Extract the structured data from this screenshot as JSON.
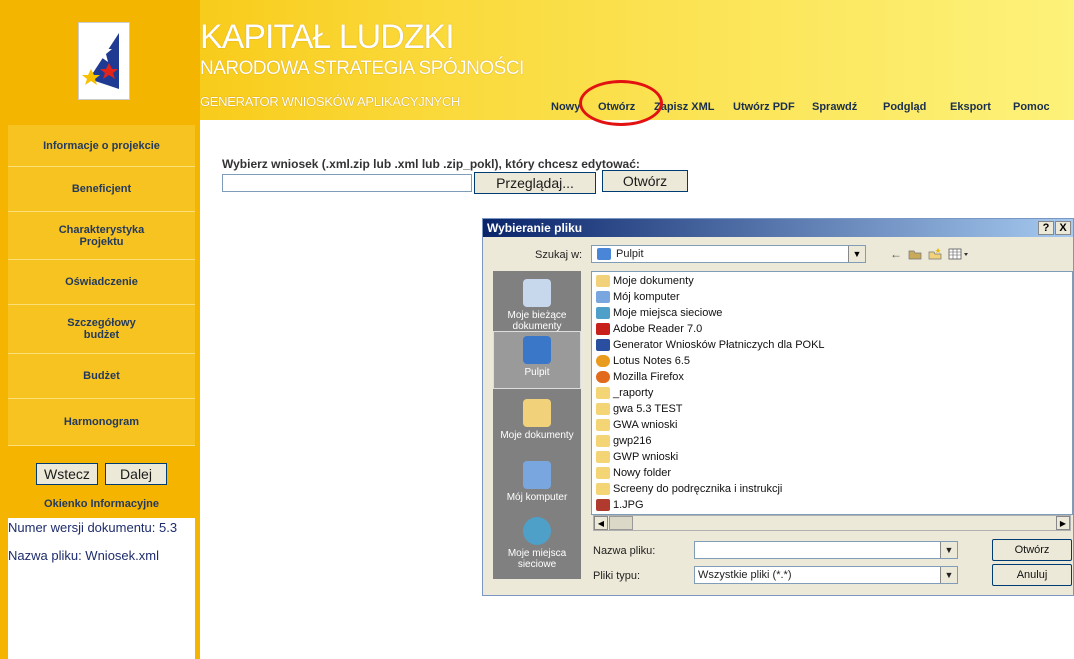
{
  "header": {
    "title": "KAPITAŁ LUDZKI",
    "subtitle": "NARODOWA STRATEGIA SPÓJNOŚCI",
    "app_name": "GENERATOR WNIOSKÓW APLIKACYJNYCH",
    "nav": [
      "Nowy",
      "Otwórz",
      "Zapisz XML",
      "Utwórz PDF",
      "Sprawdź",
      "Podgląd",
      "Eksport",
      "Pomoc"
    ],
    "highlight_color": "#e21212"
  },
  "sidebar": {
    "items": [
      "Informacje o projekcie",
      "Beneficjent",
      "Charakterystyka Projektu",
      "Oświadczenie",
      "Szczegółowy budżet",
      "Budżet",
      "Harmonogram"
    ],
    "back_label": "Wstecz",
    "next_label": "Dalej",
    "info_title": "Okienko Informacyjne",
    "info_lines": [
      "Numer wersji dokumentu: 5.3",
      "Nazwa pliku: Wniosek.xml"
    ]
  },
  "main": {
    "prompt": "Wybierz wniosek (.xml.zip lub .xml lub .zip_pokl), który chcesz edytować:",
    "file_value": "",
    "browse_label": "Przeglądaj...",
    "open_label": "Otwórz"
  },
  "dialog": {
    "title": "Wybieranie pliku",
    "help_label": "?",
    "close_label": "X",
    "lookin_label": "Szukaj w:",
    "lookin_value": "Pulpit",
    "places": [
      "Moje bieżące dokumenty",
      "Pulpit",
      "Moje dokumenty",
      "Mój komputer",
      "Moje miejsca sieciowe"
    ],
    "files": [
      {
        "name": "Moje dokumenty",
        "icon": "my-documents-icon"
      },
      {
        "name": "Mój komputer",
        "icon": "computer-icon"
      },
      {
        "name": "Moje miejsca sieciowe",
        "icon": "network-icon"
      },
      {
        "name": "Adobe Reader 7.0",
        "icon": "adobe-reader-icon"
      },
      {
        "name": "Generator Wniosków Płatniczych dla POKL",
        "icon": "app-icon"
      },
      {
        "name": "Lotus Notes 6.5",
        "icon": "lotus-notes-icon"
      },
      {
        "name": "Mozilla Firefox",
        "icon": "firefox-icon"
      },
      {
        "name": "_raporty",
        "icon": "folder-icon"
      },
      {
        "name": "gwa 5.3 TEST",
        "icon": "folder-icon"
      },
      {
        "name": "GWA wnioski",
        "icon": "folder-icon"
      },
      {
        "name": "gwp216",
        "icon": "folder-icon"
      },
      {
        "name": "GWP wnioski",
        "icon": "folder-icon"
      },
      {
        "name": "Nowy folder",
        "icon": "folder-icon"
      },
      {
        "name": "Screeny do podręcznika i instrukcji",
        "icon": "folder-icon"
      },
      {
        "name": "1.JPG",
        "icon": "image-file-icon"
      }
    ],
    "filename_label": "Nazwa pliku:",
    "filename_value": "",
    "filetype_label": "Pliki typu:",
    "filetype_value": "Wszystkie pliki (*.*)",
    "open_label": "Otwórz",
    "cancel_label": "Anuluj"
  }
}
